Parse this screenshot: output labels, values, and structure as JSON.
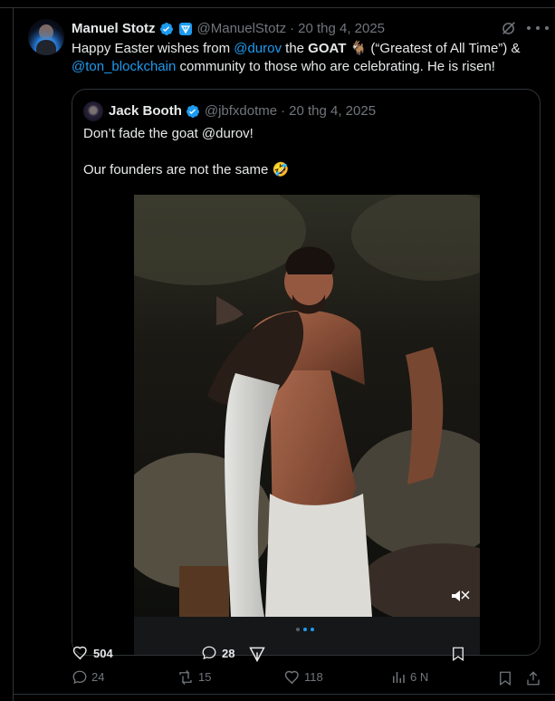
{
  "author": {
    "name": "Manuel Stotz",
    "handle": "@ManuelStotz",
    "date": "20 thg 4, 2025"
  },
  "tweet": {
    "text_1": "Happy Easter wishes from ",
    "mention_1": "@durov",
    "text_2": " the ",
    "goat_word": "GOAT",
    "goat_emoji": "🐐",
    "text_3": " (“Greatest of All Time”) &",
    "mention_2": "@ton_blockchain",
    "text_4": " community to those who are celebrating. He is risen!"
  },
  "quote": {
    "name": "Jack Booth",
    "handle": "@jbfxdotme",
    "date": "20 thg 4, 2025",
    "line1": "Don’t fade the goat @durov!",
    "line2_text": "Our founders are not the same ",
    "line2_emoji": "🤣",
    "likes": "504",
    "replies": "28"
  },
  "actions": {
    "replies": "24",
    "reposts": "15",
    "likes": "118",
    "views": "6 N"
  },
  "icons": {
    "verified": "verified-badge-icon",
    "ton": "ton-badge-icon",
    "grok": "grok-icon",
    "more": "more-icon",
    "reply": "reply-icon",
    "repost": "repost-icon",
    "like": "heart-icon",
    "views": "analytics-icon",
    "bookmark": "bookmark-icon",
    "share": "share-icon",
    "mute": "mute-icon"
  },
  "colors": {
    "background": "#000000",
    "text": "#e7e9ea",
    "muted": "#71767b",
    "accent": "#1d9bf0",
    "border": "#2f3336"
  }
}
